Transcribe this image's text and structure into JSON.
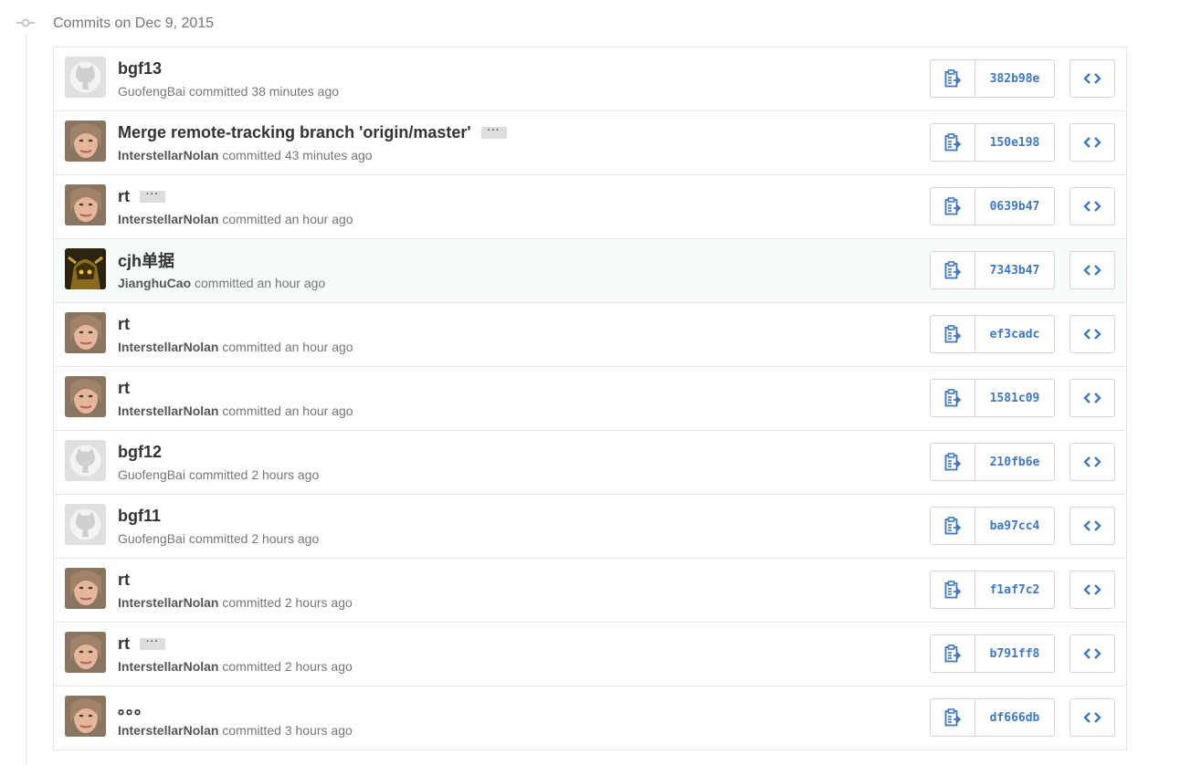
{
  "group": {
    "title": "Commits on Dec 9, 2015"
  },
  "verb": "committed",
  "colors": {
    "accent": "#4078c0",
    "muted": "#767676"
  },
  "commits": [
    {
      "title": "bgf13",
      "author": "GuofengBai",
      "time": "38 minutes ago",
      "sha": "382b98e",
      "avatar": "github-default-avatar",
      "expandable": false,
      "strong_author": false
    },
    {
      "title": "Merge remote-tracking branch 'origin/master'",
      "author": "InterstellarNolan",
      "time": "43 minutes ago",
      "sha": "150e198",
      "avatar": "user-photo-avatar",
      "expandable": true,
      "strong_author": true
    },
    {
      "title": "rt",
      "author": "InterstellarNolan",
      "time": "an hour ago",
      "sha": "0639b47",
      "avatar": "user-photo-avatar",
      "expandable": true,
      "strong_author": true
    },
    {
      "title": "cjh单据",
      "author": "JianghuCao",
      "time": "an hour ago",
      "sha": "7343b47",
      "avatar": "game-character-avatar",
      "expandable": false,
      "strong_author": true
    },
    {
      "title": "rt",
      "author": "InterstellarNolan",
      "time": "an hour ago",
      "sha": "ef3cadc",
      "avatar": "user-photo-avatar",
      "expandable": false,
      "strong_author": true
    },
    {
      "title": "rt",
      "author": "InterstellarNolan",
      "time": "an hour ago",
      "sha": "1581c09",
      "avatar": "user-photo-avatar",
      "expandable": false,
      "strong_author": true
    },
    {
      "title": "bgf12",
      "author": "GuofengBai",
      "time": "2 hours ago",
      "sha": "210fb6e",
      "avatar": "github-default-avatar",
      "expandable": false,
      "strong_author": false
    },
    {
      "title": "bgf11",
      "author": "GuofengBai",
      "time": "2 hours ago",
      "sha": "ba97cc4",
      "avatar": "github-default-avatar",
      "expandable": false,
      "strong_author": false
    },
    {
      "title": "rt",
      "author": "InterstellarNolan",
      "time": "2 hours ago",
      "sha": "f1af7c2",
      "avatar": "user-photo-avatar",
      "expandable": false,
      "strong_author": true
    },
    {
      "title": "rt",
      "author": "InterstellarNolan",
      "time": "2 hours ago",
      "sha": "b791ff8",
      "avatar": "user-photo-avatar",
      "expandable": true,
      "strong_author": true
    },
    {
      "title": "。。。",
      "author": "InterstellarNolan",
      "time": "3 hours ago",
      "sha": "df666db",
      "avatar": "user-photo-avatar",
      "expandable": false,
      "strong_author": true
    }
  ],
  "labels": {
    "ellipsis": "···"
  }
}
